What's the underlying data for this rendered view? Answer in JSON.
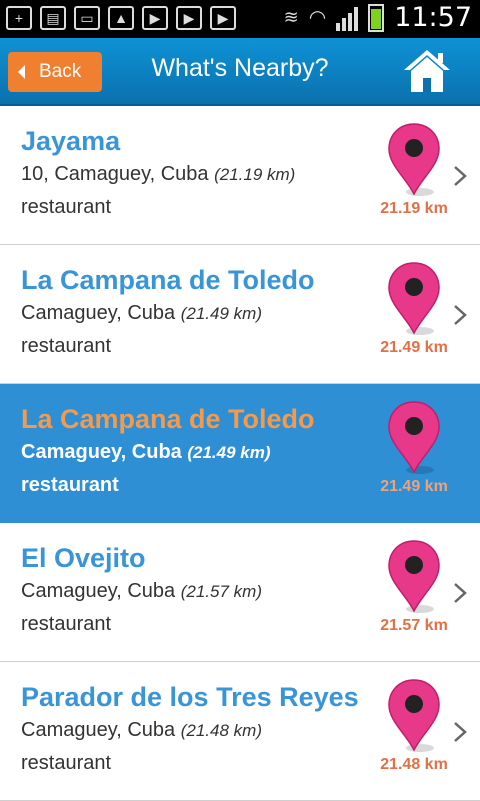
{
  "status_bar": {
    "time": "11:57"
  },
  "header": {
    "back_label": "Back",
    "title": "What's Nearby?"
  },
  "colors": {
    "header": "#0e92d6",
    "accent": "#f07f2f",
    "selected_row": "#2e8fd5",
    "pin": "#e8388a",
    "distance": "#e36f47"
  },
  "items": [
    {
      "name": "Jayama",
      "address": "10, Camaguey, Cuba",
      "distance_paren": "(21.19 km)",
      "category": "restaurant",
      "distance": "21.19 km",
      "selected": false
    },
    {
      "name": "La Campana de Toledo",
      "address": "Camaguey, Cuba",
      "distance_paren": "(21.49 km)",
      "category": "restaurant",
      "distance": "21.49 km",
      "selected": false
    },
    {
      "name": "La Campana de Toledo",
      "address": "Camaguey, Cuba",
      "distance_paren": "(21.49 km)",
      "category": "restaurant",
      "distance": "21.49 km",
      "selected": true
    },
    {
      "name": "El Ovejito",
      "address": "Camaguey, Cuba",
      "distance_paren": "(21.57 km)",
      "category": "restaurant",
      "distance": "21.57 km",
      "selected": false
    },
    {
      "name": "Parador de los Tres Reyes",
      "address": "Camaguey, Cuba",
      "distance_paren": "(21.48 km)",
      "category": "restaurant",
      "distance": "21.48 km",
      "selected": false
    }
  ]
}
